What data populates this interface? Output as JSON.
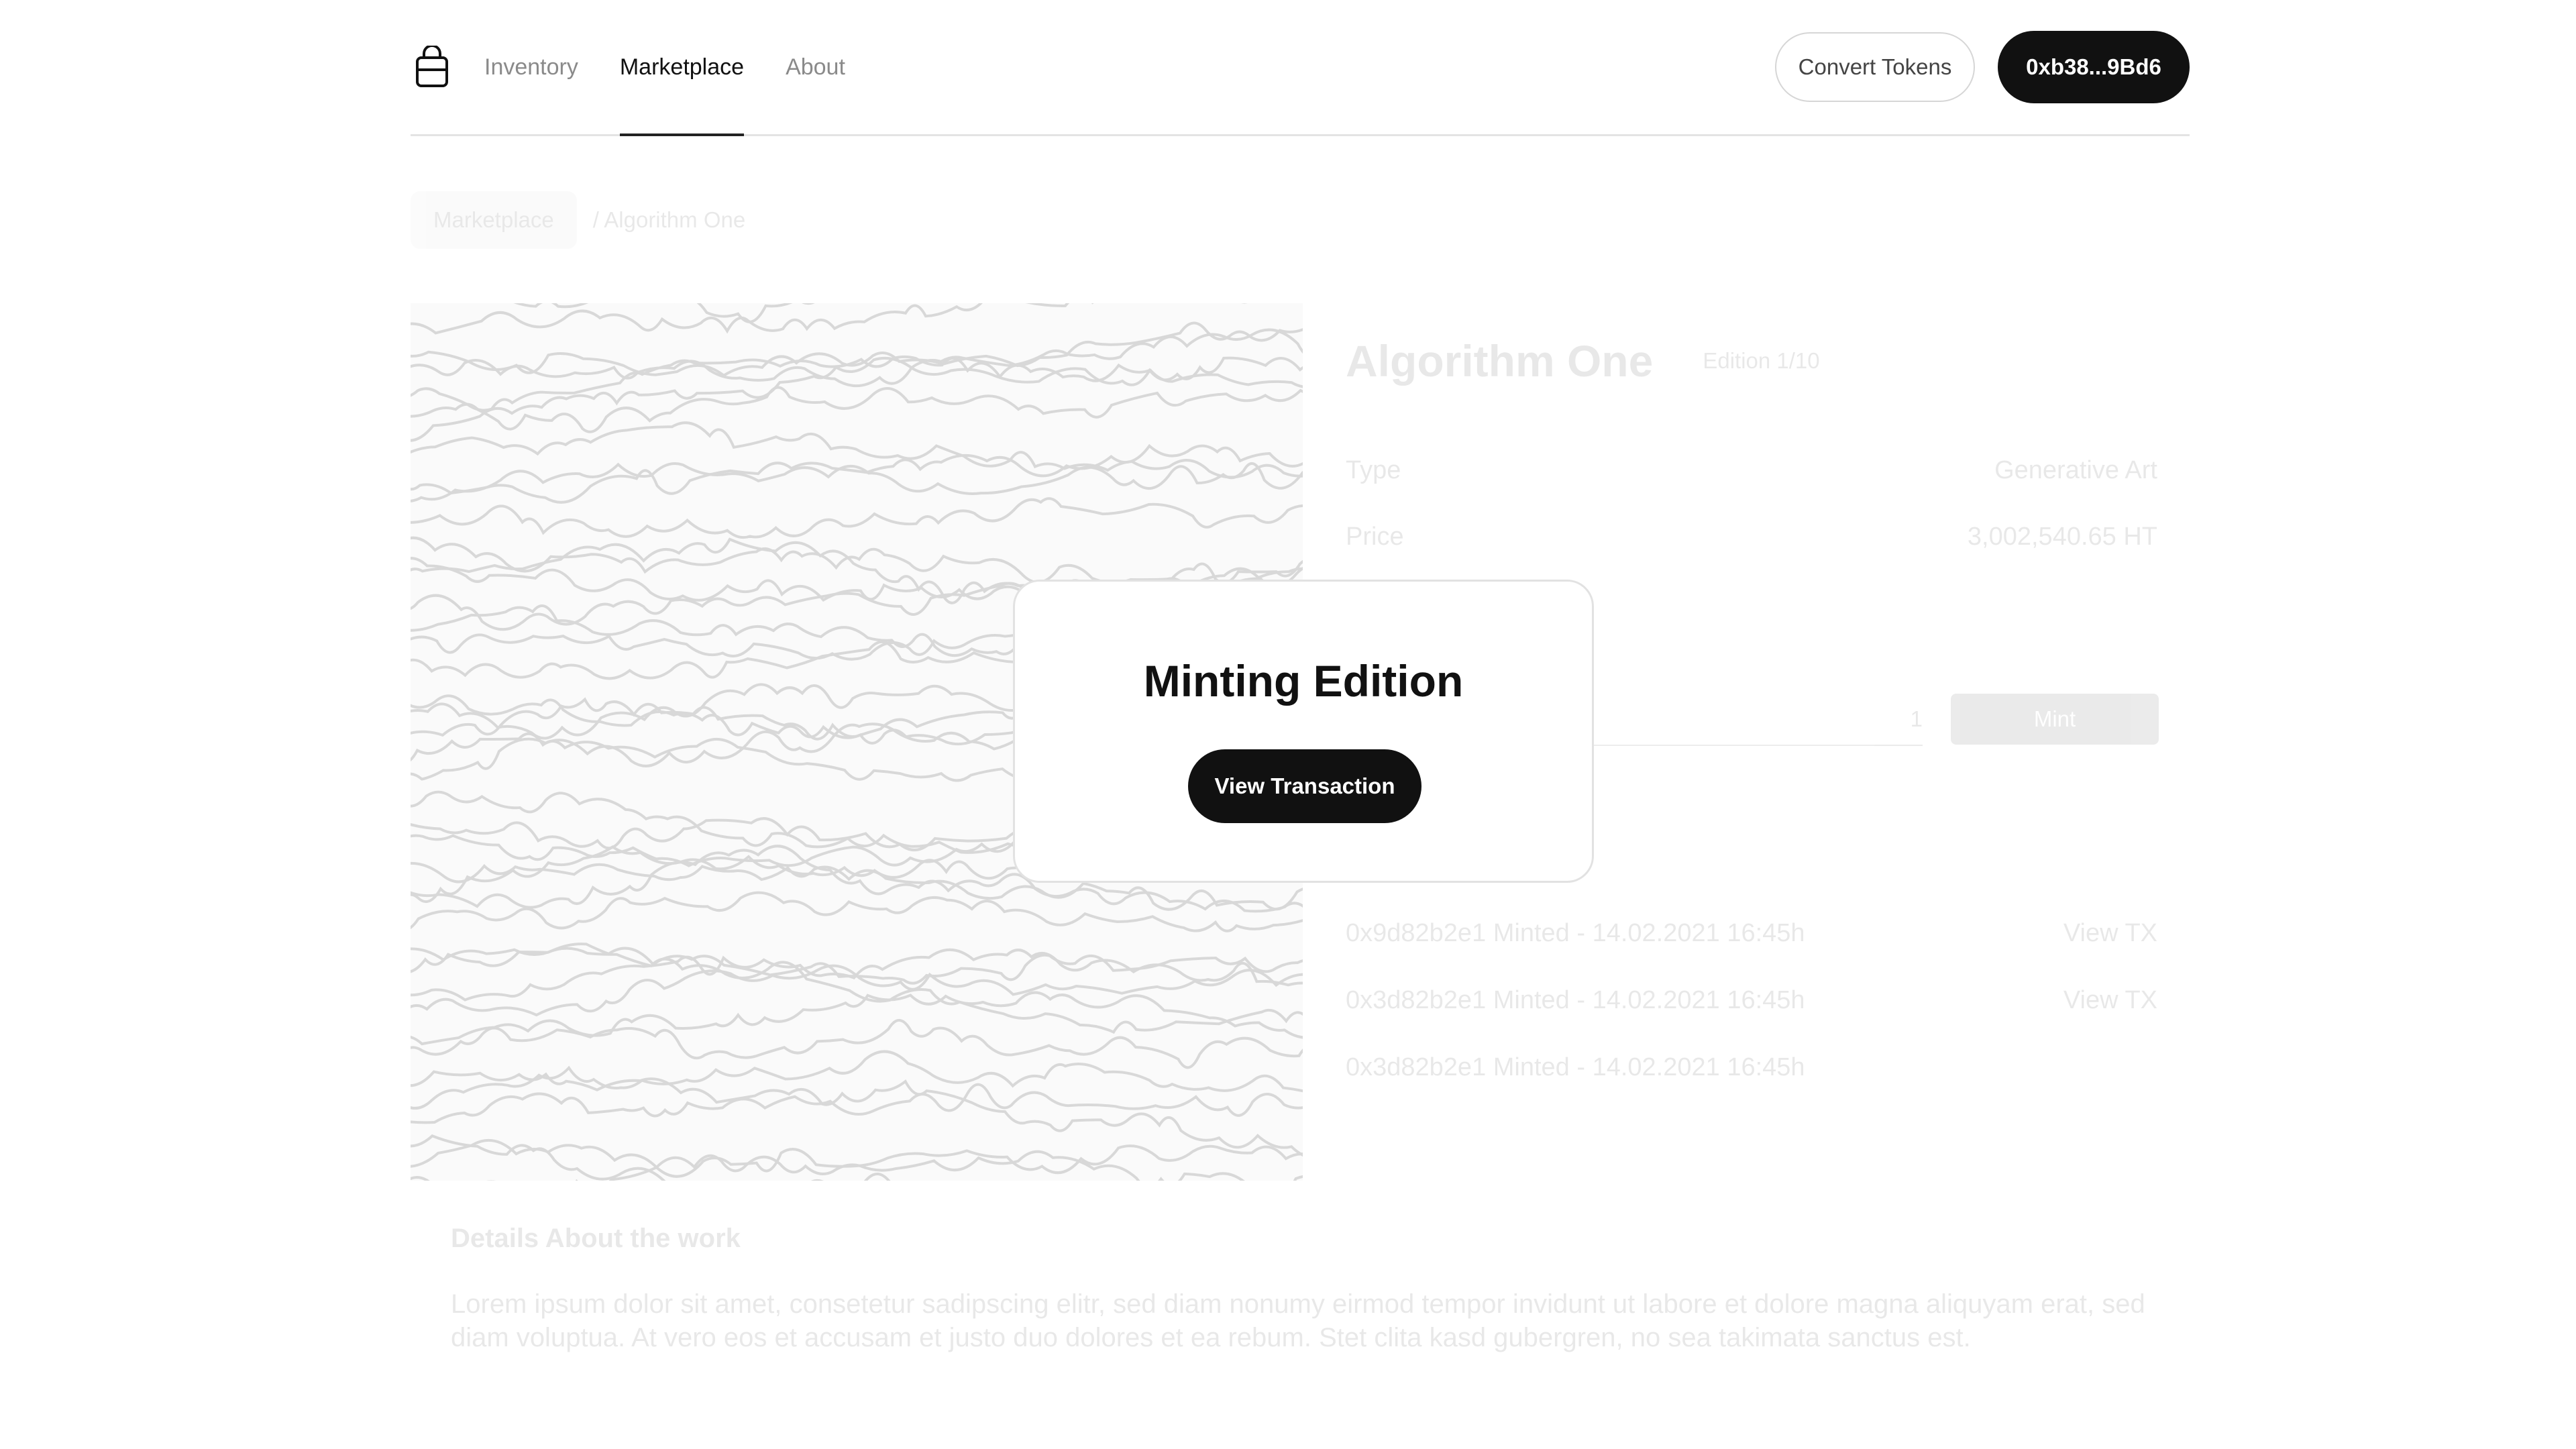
{
  "header": {
    "logo_icon": "shopping-bag-icon",
    "nav": [
      {
        "label": "Inventory",
        "active": false
      },
      {
        "label": "Marketplace",
        "active": true
      },
      {
        "label": "About",
        "active": false
      }
    ],
    "convert_label": "Convert Tokens",
    "wallet_label": "0xb38...9Bd6"
  },
  "breadcrumb": {
    "parent": "Marketplace",
    "current": "/ Algorithm One"
  },
  "artwork": {
    "title": "Algorithm One",
    "edition": "Edition 1/10",
    "type_label": "Type",
    "type_value": "Generative Art",
    "price_label": "Price",
    "price_value": "3,002,540.65 HT",
    "quantity_value": "1",
    "mint_label": "Mint",
    "transactions": [
      {
        "text": "0x9d82b2e1 Minted - 14.02.2021 16:45h",
        "link": "View TX"
      },
      {
        "text": "0x3d82b2e1 Minted - 14.02.2021 16:45h",
        "link": "View TX"
      },
      {
        "text": "0x3d82b2e1 Minted - 14.02.2021 16:45h",
        "link": ""
      }
    ]
  },
  "details": {
    "heading": "Details About the work",
    "body": "Lorem ipsum dolor sit amet, consetetur sadipscing elitr, sed diam nonumy eirmod tempor invidunt ut labore et dolore magna aliquyam erat, sed diam voluptua. At vero eos et accusam et justo duo dolores et ea rebum. Stet clita kasd gubergren, no sea takimata sanctus est."
  },
  "modal": {
    "title": "Minting Edition",
    "button_label": "View Transaction"
  }
}
